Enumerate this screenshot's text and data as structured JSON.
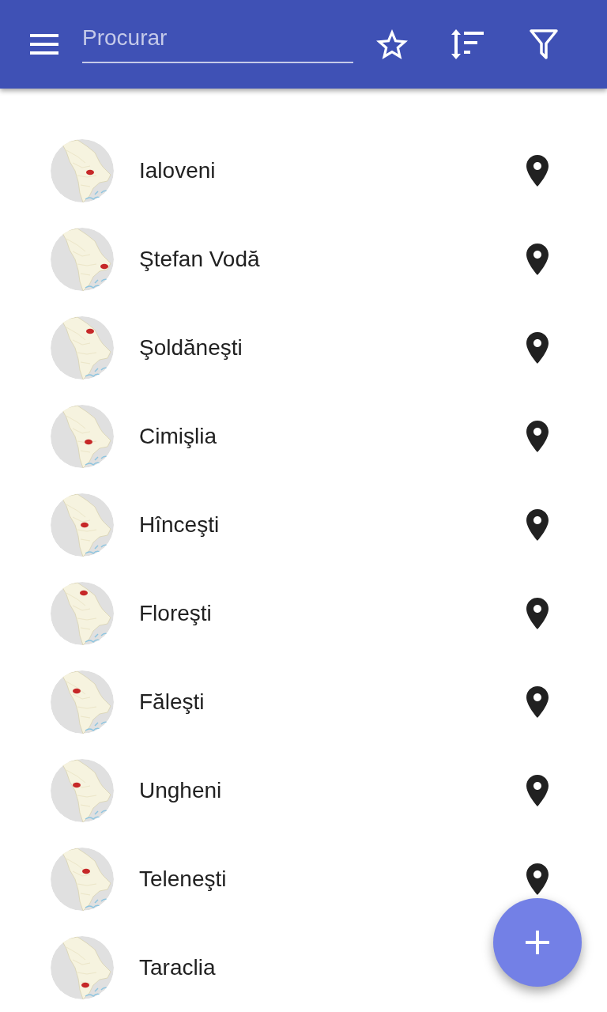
{
  "toolbar": {
    "search": {
      "placeholder": "Procurar"
    }
  },
  "districts": [
    {
      "name": "Ialoveni",
      "pin": true
    },
    {
      "name": "Ştefan Vodă",
      "pin": true
    },
    {
      "name": "Şoldăneşti",
      "pin": true
    },
    {
      "name": "Cimişlia",
      "pin": true
    },
    {
      "name": "Hînceşti",
      "pin": true
    },
    {
      "name": "Floreşti",
      "pin": true
    },
    {
      "name": "Făleşti",
      "pin": true
    },
    {
      "name": "Ungheni",
      "pin": true
    },
    {
      "name": "Teleneşti",
      "pin": true
    },
    {
      "name": "Taraclia",
      "pin": false
    }
  ]
}
